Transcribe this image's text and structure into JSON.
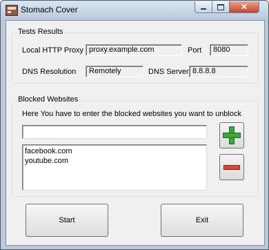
{
  "window": {
    "title": "Stomach Cover"
  },
  "tests": {
    "group_title": "Tests Results",
    "proxy_label": "Local HTTP Proxy",
    "proxy_value": "proxy.example.com",
    "port_label": "Port",
    "port_value": "8080",
    "dns_label": "DNS Resolution",
    "dns_value": "Remotely",
    "dns_server_label": "DNS Server",
    "dns_server_value": "8.8.8.8"
  },
  "blocked": {
    "group_title": "Blocked Websites",
    "instruction": "Here You have to enter the blocked websites you want to unblock",
    "input_value": "",
    "items": [
      "facebook.com",
      "youtube.com"
    ]
  },
  "buttons": {
    "start_label": "Start",
    "exit_label": "Exit"
  },
  "icons": {
    "add": "plus-icon",
    "remove": "minus-icon",
    "add_color": "#3aa83a",
    "remove_color": "#e0442a"
  }
}
